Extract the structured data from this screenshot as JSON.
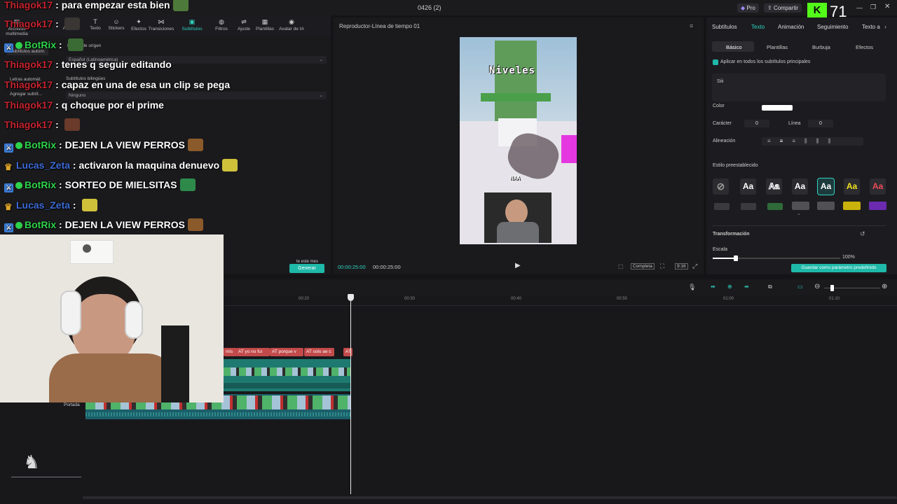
{
  "titlebar": {
    "title": "0426 (2)",
    "pro_label": "Pro",
    "share_label": "Compartir",
    "kick_count": "71"
  },
  "toolbar": {
    "items": [
      {
        "label": "Archivos multimedia",
        "icon": "media-icon"
      },
      {
        "label": "Audio",
        "icon": "audio-icon"
      },
      {
        "label": "Texto",
        "icon": "text-icon"
      },
      {
        "label": "Stickers",
        "icon": "sticker-icon"
      },
      {
        "label": "Efectos",
        "icon": "effects-icon"
      },
      {
        "label": "Transiciones",
        "icon": "transitions-icon"
      },
      {
        "label": "Subtítulos",
        "icon": "subtitles-icon"
      },
      {
        "label": "Filtros",
        "icon": "filters-icon"
      },
      {
        "label": "Ajuste",
        "icon": "adjust-icon"
      },
      {
        "label": "Plantillas",
        "icon": "templates-icon"
      },
      {
        "label": "Avatar de IA",
        "icon": "avatar-icon"
      }
    ]
  },
  "leftpanel": {
    "side_items": [
      "Subtítulos autom.",
      "Letras automát.",
      "Agregar subtít..."
    ],
    "source_label": "Idioma de origen",
    "source_value": "Español (Latinoamérica)",
    "bilingual_label": "Subtítulos bilingües",
    "bilingual_value": "Ninguno",
    "month_note": "te este mes",
    "generate_label": "Generar"
  },
  "chat": [
    {
      "user": "Thiagok17",
      "type": "thiago",
      "msg": "para empezar esta bien",
      "emote": true
    },
    {
      "user": "Thiagok17",
      "type": "thiago",
      "msg": "",
      "emote": true
    },
    {
      "user": "BotRix",
      "type": "botrix",
      "msg": "",
      "emote": true
    },
    {
      "user": "Thiagok17",
      "type": "thiago",
      "msg": "tenes q seguir editando",
      "emote": false
    },
    {
      "user": "Thiagok17",
      "type": "thiago",
      "msg": "capaz en una de esa un clip se pega",
      "emote": false
    },
    {
      "user": "Thiagok17",
      "type": "thiago",
      "msg": "q choque por el prime",
      "emote": false
    },
    {
      "user": "Thiagok17",
      "type": "thiago",
      "msg": "",
      "emote": true
    },
    {
      "user": "BotRix",
      "type": "botrix",
      "msg": "DEJEN LA VIEW PERROS",
      "emote": true
    },
    {
      "user": "Lucas_Zeta",
      "type": "lucas",
      "msg": "activaron la maquina denuevo",
      "emote": true
    },
    {
      "user": "BotRix",
      "type": "botrix",
      "msg": "SORTEO DE MIELSITAS",
      "emote": true
    },
    {
      "user": "Lucas_Zeta",
      "type": "lucas",
      "msg": "",
      "emote": true
    },
    {
      "user": "BotRix",
      "type": "botrix",
      "msg": "DEJEN LA VIEW PERROS",
      "emote": true
    }
  ],
  "player": {
    "title": "Reproductor-Línea de tiempo 01",
    "current_time": "00:00:25:00",
    "total_time": "00:00:25:00",
    "ratio_label": "9:16",
    "complete_label": "Completa",
    "video_text": "Niveles",
    "video_badge": "NAA"
  },
  "rightpanel": {
    "tabs": [
      "Subtítulos",
      "Texto",
      "Animación",
      "Seguimiento",
      "Texto a"
    ],
    "active_tab": "Texto",
    "subtabs": [
      "Básico",
      "Plantillas",
      "Burbuja",
      "Efectos"
    ],
    "apply_all": "Aplicar en todos los subtítulos principales",
    "text_value": "Siii",
    "color_label": "Color",
    "char_label": "Carácter",
    "char_value": "0",
    "line_label": "Línea",
    "line_value": "0",
    "align_label": "Alineación",
    "preset_label": "Estilo preestablecido",
    "preset_text": "Aa",
    "transform_label": "Transformación",
    "scale_label": "Escala",
    "scale_value": "100%",
    "save_default": "Guardar como parámetro predefinido"
  },
  "timeline": {
    "ticks": [
      "00:20",
      "00:30",
      "00:40",
      "00:50",
      "01:00",
      "01:10"
    ],
    "captions": [
      "mis",
      "AT yo no fui",
      "AT porque v",
      "AT solo ae c",
      "AT"
    ],
    "cover_label": "Portada"
  }
}
